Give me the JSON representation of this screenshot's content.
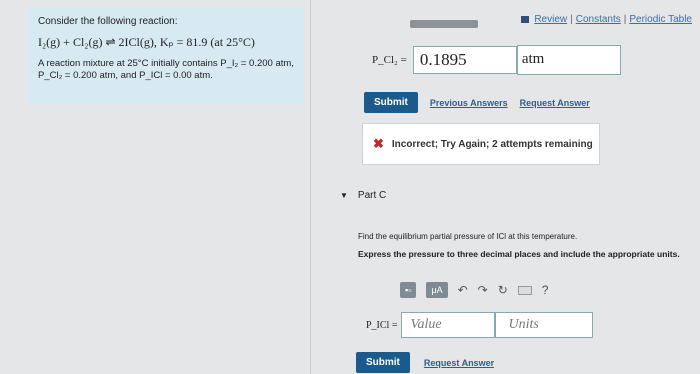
{
  "header": {
    "review_label": "Review",
    "constants_label": "Constants",
    "periodic_label": "Periodic Table",
    "separator": "|"
  },
  "problem": {
    "intro": "Consider the following reaction:",
    "equation": "I₂(g) + Cl₂(g) ⇌ 2ICl(g),   Kₚ = 81.9 (at 25°C)",
    "body": "A reaction mixture at 25°C initially contains P_I₂ = 0.200 atm, P_Cl₂ = 0.200 atm, and P_ICl = 0.00 atm."
  },
  "part_b": {
    "answer_label": "P_Cl₂ =",
    "answer_value": "0.1895",
    "answer_unit": "atm",
    "submit_label": "Submit",
    "previous_answers_label": "Previous Answers",
    "request_answer_label": "Request Answer",
    "feedback": "Incorrect; Try Again; 2 attempts remaining"
  },
  "part_c": {
    "title": "Part C",
    "question": "Find the equilibrium partial pressure of ICl at this temperature.",
    "instruction": "Express the pressure to three decimal places and include the appropriate units.",
    "toolbar_mu": "μA",
    "toolbar_help": "?",
    "answer_label": "P_ICl =",
    "value_placeholder": "Value",
    "units_placeholder": "Units",
    "submit_label": "Submit",
    "request_answer_label": "Request Answer"
  }
}
